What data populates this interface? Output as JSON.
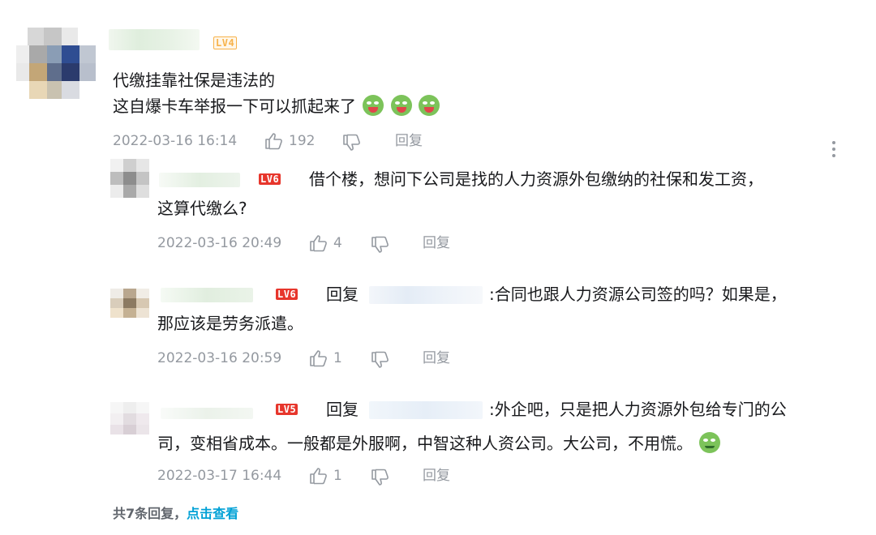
{
  "comment": {
    "level": "LV4",
    "text_line1": "代缴挂靠社保是违法的",
    "text_line2": "这自爆卡车举报一下可以抓起来了",
    "emoji": "sick-face-emoji",
    "date": "2022-03-16 16:14",
    "likes": "192",
    "reply_label": "回复"
  },
  "replies": [
    {
      "level": "LV6",
      "line1": "借个楼，想问下公司是找的人力资源外包缴纳的社保和发工资，",
      "line2": "这算代缴么?",
      "date": "2022-03-16 20:49",
      "likes": "4",
      "reply_label": "回复"
    },
    {
      "level": "LV6",
      "reply_prefix": "回复",
      "line1": ":合同也跟人力资源公司签的吗？如果是，",
      "line2": "那应该是劳务派遣。",
      "date": "2022-03-16 20:59",
      "likes": "1",
      "reply_label": "回复"
    },
    {
      "level": "LV5",
      "reply_prefix": "回复",
      "line1": ":外企吧，只是把人力资源外包给专门的公",
      "line2": "司，变相省成本。一般都是外服啊，中智这种人资公司。大公司，不用慌。",
      "emoji": "smirk-face-emoji",
      "date": "2022-03-17 16:44",
      "likes": "1",
      "reply_label": "回复"
    }
  ],
  "footer": {
    "count_text": "共7条回复，",
    "link_text": "点击查看"
  },
  "colors": {
    "meta_gray": "#9499a0",
    "link_blue": "#00a1d6",
    "level_red": "#e7362c",
    "level_orange": "#f7b24a"
  }
}
